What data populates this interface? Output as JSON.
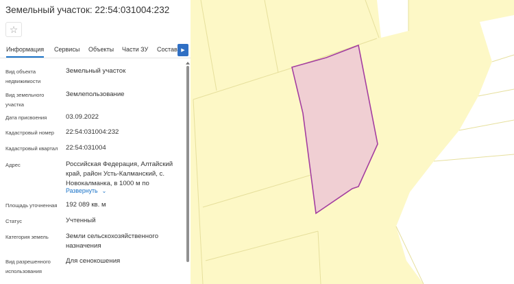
{
  "header": {
    "title": "Земельный участок: 22:54:031004:232",
    "favorite_icon": "star-icon"
  },
  "tabs": [
    {
      "label": "Информация",
      "active": true
    },
    {
      "label": "Сервисы",
      "active": false
    },
    {
      "label": "Объекты",
      "active": false
    },
    {
      "label": "Части ЗУ",
      "active": false
    },
    {
      "label": "Состав",
      "active": false
    }
  ],
  "tabs_next_icon": "chevron-right-icon",
  "properties": [
    {
      "label": "Вид объекта недвижимости",
      "value": "Земельный участок"
    },
    {
      "label": "Вид земельного участка",
      "value": "Землепользование"
    },
    {
      "label": "Дата присвоения",
      "value": "03.09.2022"
    },
    {
      "label": "Кадастровый номер",
      "value": "22:54:031004:232"
    },
    {
      "label": "Кадастровый квартал",
      "value": "22:54:031004"
    },
    {
      "label": "Адрес",
      "value": "Российская Федерация, Алтайский край, район Усть-Калманский, с. Новокалманка, в 1000 м по"
    },
    {
      "label": "Площадь уточненная",
      "value": "192 089 кв. м"
    },
    {
      "label": "Статус",
      "value": "Учтенный"
    },
    {
      "label": "Категория земель",
      "value": "Земли сельскохозяйственного назначения"
    },
    {
      "label": "Вид разрешенного использования",
      "value": "Для сенокошения"
    }
  ],
  "address_expand": {
    "label": "Развернуть",
    "icon": "chevron-down-icon"
  },
  "colors": {
    "accent": "#1a73c8",
    "map_parcel_fill": "#fdf8c6",
    "map_parcel_border": "#e0da9a",
    "selected_fill": "#f0cfd3",
    "selected_border": "#a33ea0"
  }
}
